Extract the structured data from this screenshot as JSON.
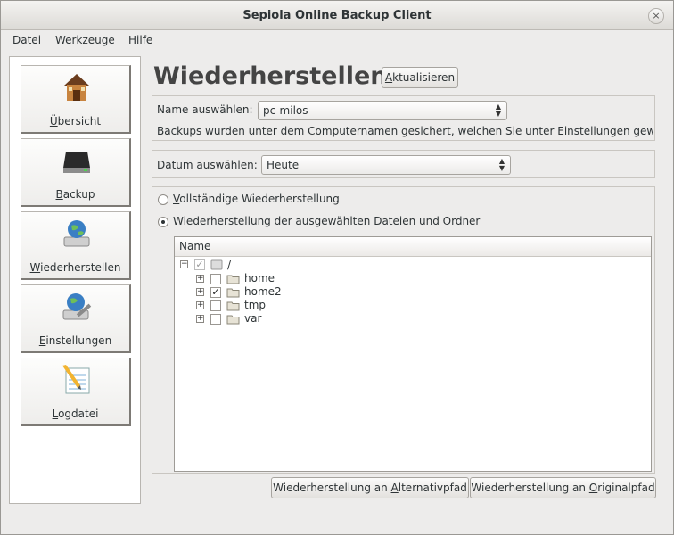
{
  "window": {
    "title": "Sepiola Online Backup Client",
    "close_glyph": "×"
  },
  "menu": [
    {
      "mnemonic": "D",
      "rest": "atei"
    },
    {
      "mnemonic": "W",
      "rest": "erkzeuge"
    },
    {
      "mnemonic": "H",
      "rest": "ilfe"
    }
  ],
  "sidebar": {
    "items": [
      {
        "mnemonic": "Ü",
        "rest": "bersicht",
        "icon": "house-icon"
      },
      {
        "mnemonic": "B",
        "rest": "ackup",
        "icon": "hard-drive-icon"
      },
      {
        "mnemonic": "W",
        "rest": "iederherstellen",
        "icon": "drive-globe-icon"
      },
      {
        "mnemonic": "E",
        "rest": "instellungen",
        "icon": "settings-tools-icon"
      },
      {
        "mnemonic": "L",
        "rest": "ogdatei",
        "icon": "notepad-pencil-icon"
      }
    ]
  },
  "main": {
    "title": "Wiederherstellen",
    "refresh": {
      "mnemonic": "A",
      "rest": "ktualisieren"
    },
    "name_label": "Name auswählen:",
    "name_value": "pc-milos",
    "info_text": "Backups wurden unter dem Computernamen gesichert, welchen Sie unter Einstellungen gewä",
    "date_label": "Datum auswählen:",
    "date_value": "Heute",
    "radio_full": {
      "pre": "",
      "mnemonic": "V",
      "rest": "ollständige Wiederherstellung",
      "selected": false
    },
    "radio_selected": {
      "pre": "Wiederherstellung der ausgewählten ",
      "mnemonic": "D",
      "rest": "ateien und Ordner",
      "selected": true
    },
    "tree": {
      "header": "Name",
      "root": {
        "name": "/",
        "expanded": true
      },
      "children": [
        {
          "name": "home",
          "checked": false
        },
        {
          "name": "home2",
          "checked": true
        },
        {
          "name": "tmp",
          "checked": false
        },
        {
          "name": "var",
          "checked": false
        }
      ]
    },
    "btn_alt": {
      "pre": "Wiederherstellung an ",
      "mnemonic": "A",
      "rest": "lternativpfad"
    },
    "btn_orig": {
      "pre": "Wiederherstellung an ",
      "mnemonic": "O",
      "rest": "riginalpfad"
    }
  }
}
